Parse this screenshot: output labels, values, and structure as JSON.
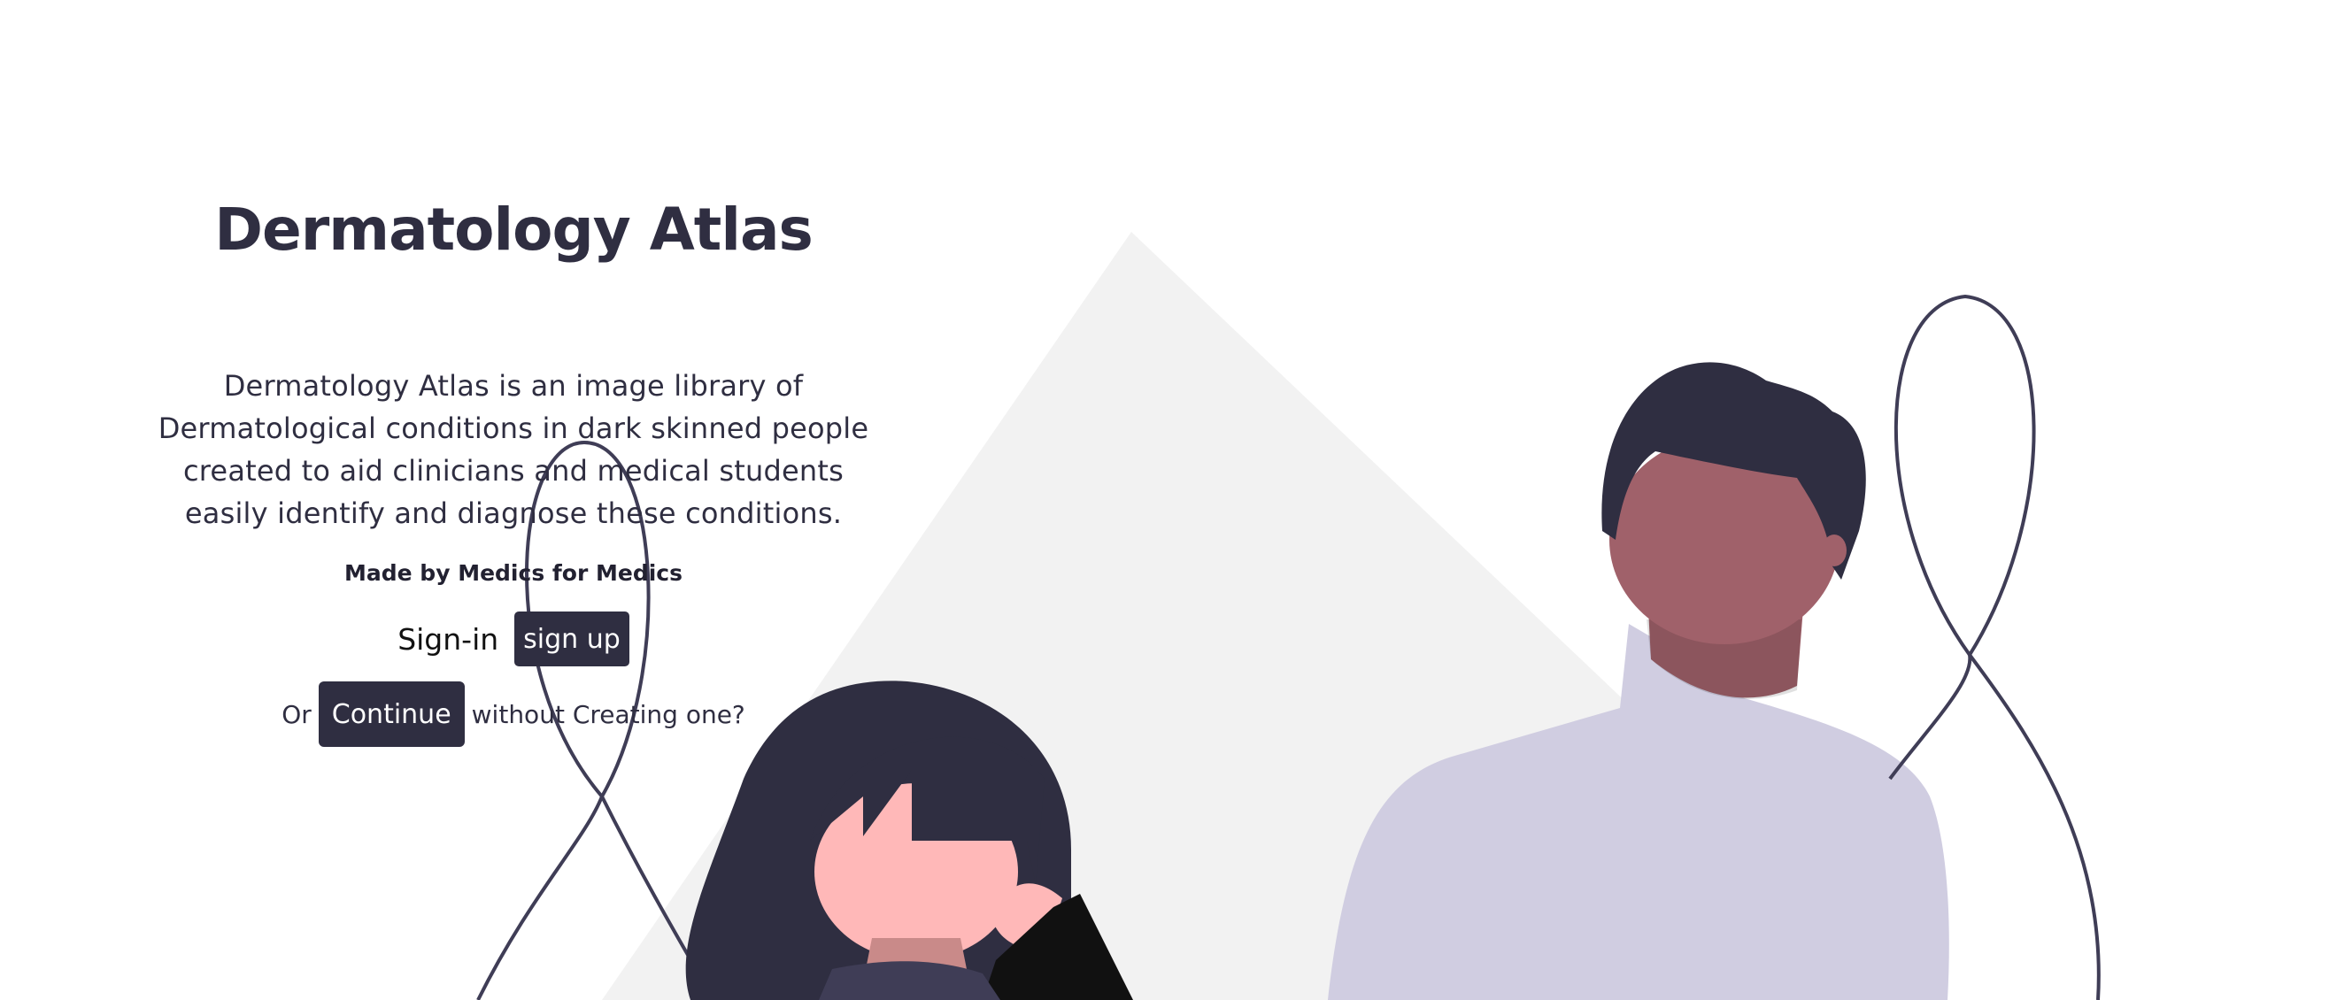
{
  "hero": {
    "title": "Dermatology Atlas",
    "description": "Dermatology Atlas is an image library of Dermatological conditions in dark skinned people created to aid clinicians and medical students easily identify and diagnose these conditions.",
    "tagline": "Made by Medics for Medics"
  },
  "auth": {
    "signin_label": "Sign-in",
    "signup_label": "sign up"
  },
  "guest": {
    "prefix": "Or",
    "continue_label": "Continue",
    "suffix": "without Creating one?"
  },
  "colors": {
    "primary_dark": "#2f2e41",
    "triangle_gray": "#f2f2f2",
    "shirt_lavender": "#d0cde1",
    "skin_dark": "#a0616a",
    "skin_light": "#ffb8b8"
  },
  "icons": {
    "illustration": "people-illustration"
  }
}
